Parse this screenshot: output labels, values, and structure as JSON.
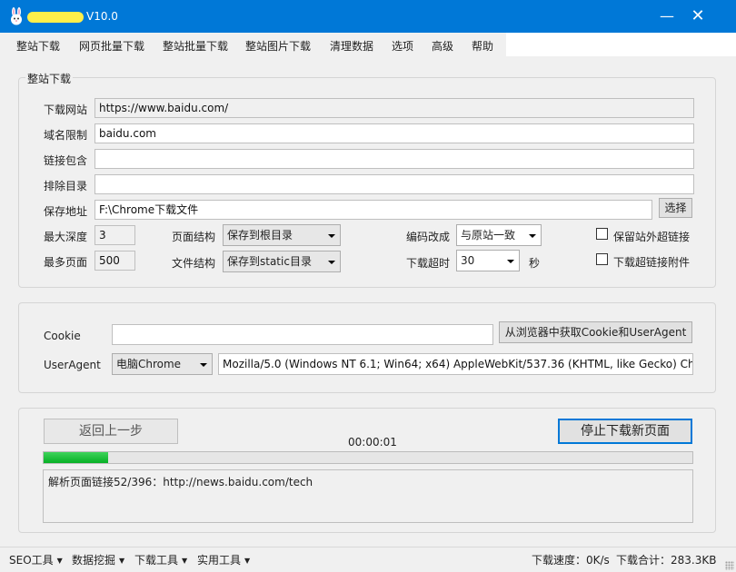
{
  "window": {
    "title": "V10.0",
    "minimize": "—",
    "close": "✕"
  },
  "menu": [
    "整站下载",
    "网页批量下载",
    "整站批量下载",
    "整站图片下载",
    "清理数据",
    "选项",
    "高级",
    "帮助"
  ],
  "site_download": {
    "group_title": "整站下载",
    "url_label": "下载网站",
    "url_value": "https://www.baidu.com/",
    "domain_label": "域名限制",
    "domain_value": "baidu.com",
    "contains_label": "链接包含",
    "contains_value": "",
    "exclude_label": "排除目录",
    "exclude_value": "",
    "save_label": "保存地址",
    "save_value": "F:\\Chrome下载文件",
    "browse_button": "选择",
    "depth_label": "最大深度",
    "depth_value": "3",
    "pages_label": "最多页面",
    "pages_value": "500",
    "page_structure_label": "页面结构",
    "page_structure_value": "保存到根目录",
    "file_structure_label": "文件结构",
    "file_structure_value": "保存到static目录",
    "encoding_label": "编码改成",
    "encoding_value": "与原站一致",
    "timeout_label": "下载超时",
    "timeout_value": "30",
    "timeout_unit": "秒",
    "keep_external_label": "保留站外超链接",
    "keep_external_checked": false,
    "download_attachments_label": "下载超链接附件",
    "download_attachments_checked": false
  },
  "headers": {
    "cookie_label": "Cookie",
    "cookie_value": "",
    "get_from_browser_button": "从浏览器中获取Cookie和UserAgent",
    "useragent_label": "UserAgent",
    "browser_select": "电脑Chrome",
    "useragent_value": "Mozilla/5.0 (Windows NT 6.1; Win64; x64) AppleWebKit/537.36 (KHTML, like Gecko) Chro"
  },
  "progress": {
    "back_button": "返回上一步",
    "stop_button": "停止下载新页面",
    "elapsed": "00:00:01",
    "fraction": 0.1,
    "log_text": "解析页面链接52/396：http://news.baidu.com/tech"
  },
  "statusbar": {
    "menus": [
      "SEO工具",
      "数据挖掘",
      "下载工具",
      "实用工具"
    ],
    "speed": "下载速度：0K/s",
    "total": "下载合计：283.3KB"
  },
  "colors": {
    "titlebar": "#0078d7",
    "progress_fill": "#06b025",
    "default_button_border": "#0078d7"
  }
}
